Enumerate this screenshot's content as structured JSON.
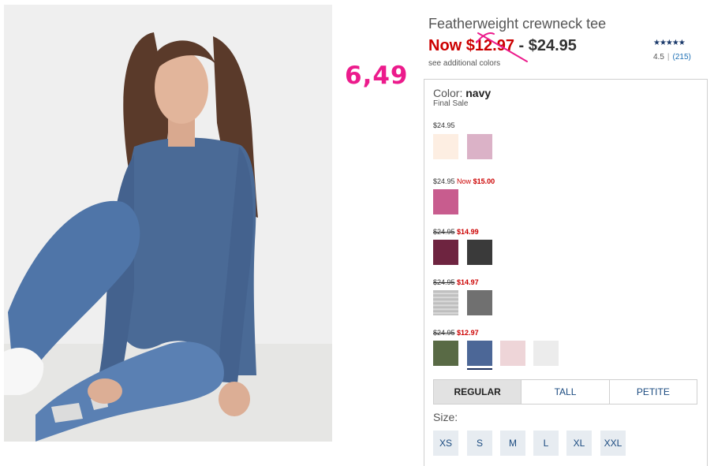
{
  "product": {
    "title": "Featherweight crewneck tee",
    "now_label": "Now",
    "sale_price": "$12.97",
    "separator": "-",
    "regular_price": "$24.95",
    "see_colors": "see additional colors"
  },
  "rating": {
    "stars": "★★★★★",
    "value": "4.5",
    "divider": "|",
    "count": "(215)"
  },
  "annotation": {
    "handwritten_price": "6,49",
    "color": "#ec1b8c"
  },
  "color_selector": {
    "label": "Color:",
    "selected": "navy",
    "final_sale": "Final Sale",
    "groups": [
      {
        "price": "$24.95",
        "swatches": [
          "#fdeee2",
          "#dbb2c7"
        ]
      },
      {
        "price": "$24.95",
        "now_label": "Now",
        "sale_price": "$15.00",
        "swatches": [
          "#c85c8e"
        ]
      },
      {
        "old_price": "$24.95",
        "sale_price": "$14.99",
        "swatches": [
          "#6e2440",
          "#3a3a3a"
        ]
      },
      {
        "old_price": "$24.95",
        "sale_price": "$14.97",
        "swatches": [
          "#c8c8c8",
          "#707070"
        ]
      },
      {
        "old_price": "$24.95",
        "sale_price": "$12.97",
        "swatches": [
          "#596a45",
          "#4c6797",
          "#eed5d8",
          "#ececec"
        ]
      }
    ]
  },
  "fit_tabs": [
    {
      "label": "REGULAR",
      "active": true
    },
    {
      "label": "TALL",
      "active": false
    },
    {
      "label": "PETITE",
      "active": false
    }
  ],
  "size": {
    "label": "Size:",
    "options": [
      "XS",
      "S",
      "M",
      "L",
      "XL",
      "XXL"
    ]
  },
  "colors": {
    "sale_red": "#cc0000",
    "link_blue": "#1b6fb5",
    "tab_text": "#1b4b80"
  }
}
